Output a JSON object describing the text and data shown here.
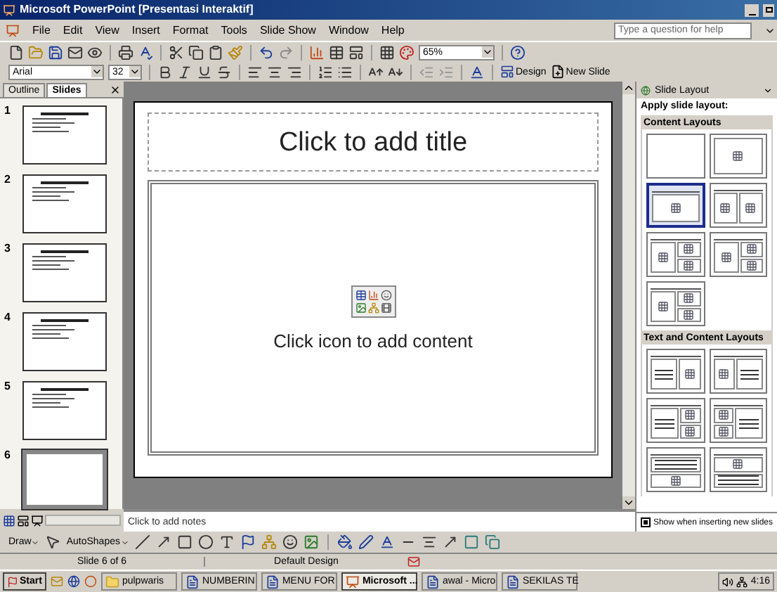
{
  "window": {
    "title": "Microsoft PowerPoint  [Presentasi Interaktif]"
  },
  "menu": [
    "File",
    "Edit",
    "View",
    "Insert",
    "Format",
    "Tools",
    "Slide Show",
    "Window",
    "Help"
  ],
  "help_box": {
    "placeholder": "Type a question for help"
  },
  "toolbar": {
    "zoom": "65%"
  },
  "formatting": {
    "font": "Arial",
    "size": "32",
    "design": "Design",
    "new_slide": "New Slide"
  },
  "pane_tabs": [
    {
      "label": "Outline",
      "selected": false
    },
    {
      "label": "Slides",
      "selected": true
    }
  ],
  "slides": [
    {
      "number": "1",
      "selected": false
    },
    {
      "number": "2",
      "selected": false
    },
    {
      "number": "3",
      "selected": false
    },
    {
      "number": "4",
      "selected": false
    },
    {
      "number": "5",
      "selected": false
    },
    {
      "number": "6",
      "selected": true
    }
  ],
  "slide": {
    "title_placeholder": "Click to add title",
    "content_placeholder": "Click icon to add content"
  },
  "notes": {
    "placeholder": "Click to add notes"
  },
  "task_pane": {
    "title": "Slide Layout",
    "heading": "Apply slide layout:",
    "sections": [
      {
        "title": "Content Layouts",
        "layouts": [
          {
            "kind": "blank",
            "selected": false
          },
          {
            "kind": "content",
            "selected": false
          },
          {
            "kind": "title-content",
            "selected": true
          },
          {
            "kind": "two-content",
            "selected": false
          },
          {
            "kind": "content-four",
            "selected": false
          },
          {
            "kind": "four-content",
            "selected": false
          },
          {
            "kind": "four",
            "selected": false
          }
        ]
      },
      {
        "title": "Text and Content Layouts",
        "layouts": [
          {
            "kind": "text-content",
            "selected": false
          },
          {
            "kind": "content-text",
            "selected": false
          },
          {
            "kind": "text-four",
            "selected": false
          },
          {
            "kind": "four-text",
            "selected": false
          },
          {
            "kind": "text-over",
            "selected": false
          },
          {
            "kind": "over-text",
            "selected": false
          }
        ]
      }
    ],
    "show_on_insert": {
      "label": "Show when inserting new slides",
      "checked": true
    }
  },
  "drawing_toolbar": {
    "draw": "Draw",
    "autoshapes": "AutoShapes"
  },
  "status_bar": {
    "slide": "Slide 6 of 6",
    "design": "Default Design"
  },
  "taskbar": {
    "start": "Start",
    "items": [
      {
        "label": "pulpwaris",
        "kind": "folder",
        "selected": false
      },
      {
        "label": "NUMBERIN",
        "kind": "document",
        "selected": false
      },
      {
        "label": "MENU FOR",
        "kind": "document",
        "selected": false
      },
      {
        "label": "Microsoft ...",
        "kind": "powerpoint",
        "selected": true
      },
      {
        "label": "awal - Micro",
        "kind": "document",
        "selected": false
      },
      {
        "label": "SEKILAS TE",
        "kind": "document",
        "selected": false
      }
    ],
    "clock": "4:16"
  }
}
